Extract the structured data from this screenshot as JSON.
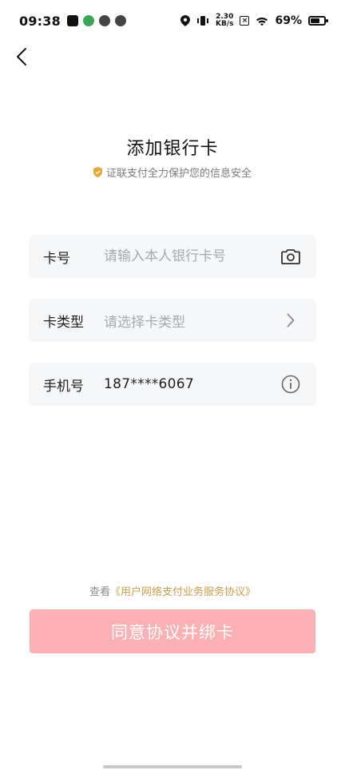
{
  "status_bar": {
    "time": "09:38",
    "net_speed_value": "2.30",
    "net_speed_unit": "KB/s",
    "battery_percent": "69%",
    "battery_level": 0.69
  },
  "page": {
    "title": "添加银行卡",
    "subtitle": "证联支付全力保护您的信息安全"
  },
  "fields": {
    "card_number": {
      "label": "卡号",
      "placeholder": "请输入本人银行卡号",
      "value": ""
    },
    "card_type": {
      "label": "卡类型",
      "placeholder": "请选择卡类型"
    },
    "phone": {
      "label": "手机号",
      "value": "187****6067"
    }
  },
  "agreement": {
    "prefix": "查看",
    "link": "《用户网络支付业务服务协议》"
  },
  "submit": {
    "label": "同意协议并绑卡"
  },
  "colors": {
    "accent_gold": "#c8a04a",
    "button_disabled": "#fbb1b3",
    "field_bg": "#f6f7f9"
  }
}
